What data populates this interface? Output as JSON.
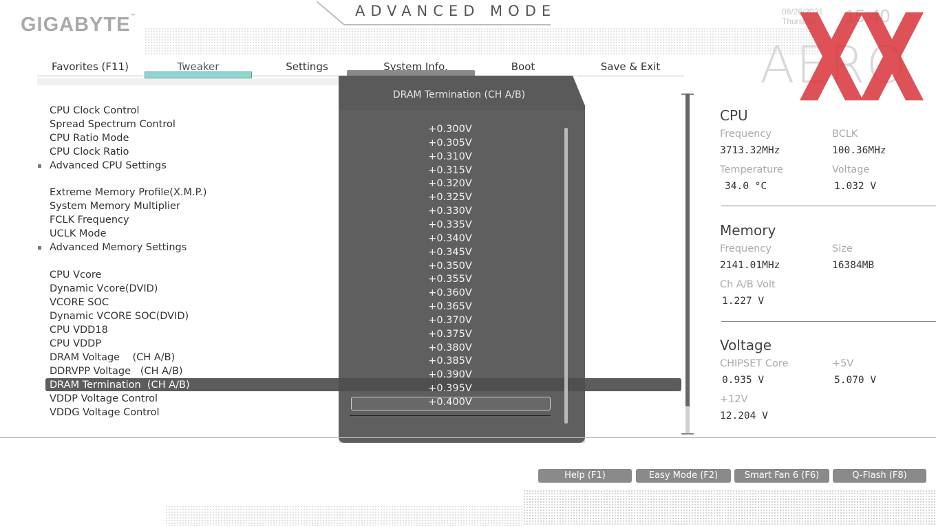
{
  "header": {
    "brand": "GIGABYTE",
    "brand_mark": "™",
    "mode_title": "ADVANCED MODE",
    "date": "08/26/2021",
    "weekday": "Thursday",
    "time": "15:40",
    "aero_logo": "AERO",
    "watermark_color": "#d9343a"
  },
  "tabs": [
    {
      "label": "Favorites (F11)",
      "active": false
    },
    {
      "label": "Tweaker",
      "active": true
    },
    {
      "label": "Settings",
      "active": false
    },
    {
      "label": "System Info.",
      "active": false
    },
    {
      "label": "Boot",
      "active": false
    },
    {
      "label": "Save & Exit",
      "active": false
    }
  ],
  "menu": [
    {
      "label": "CPU Clock Control"
    },
    {
      "label": "Spread Spectrum Control"
    },
    {
      "label": "CPU Ratio Mode"
    },
    {
      "label": "CPU Clock Ratio"
    },
    {
      "label": "Advanced CPU Settings",
      "submenu": true
    },
    {
      "label": "Extreme Memory Profile(X.M.P.)"
    },
    {
      "label": "System Memory Multiplier"
    },
    {
      "label": "FCLK Frequency"
    },
    {
      "label": "UCLK Mode"
    },
    {
      "label": "Advanced Memory Settings",
      "submenu": true
    },
    {
      "label": "CPU Vcore"
    },
    {
      "label": "Dynamic Vcore(DVID)"
    },
    {
      "label": "VCORE SOC"
    },
    {
      "label": "Dynamic VCORE SOC(DVID)"
    },
    {
      "label": "CPU VDD18"
    },
    {
      "label": "CPU VDDP"
    },
    {
      "label": "DRAM Voltage    (CH A/B)"
    },
    {
      "label": "DDRVPP Voltage   (CH A/B)"
    },
    {
      "label": "DRAM Termination  (CH A/B)",
      "selected": true
    },
    {
      "label": "VDDP Voltage Control"
    },
    {
      "label": "VDDG Voltage Control"
    }
  ],
  "popup": {
    "title": "DRAM Termination  (CH A/B)",
    "options": [
      "+0.300V",
      "+0.305V",
      "+0.310V",
      "+0.315V",
      "+0.320V",
      "+0.325V",
      "+0.330V",
      "+0.335V",
      "+0.340V",
      "+0.345V",
      "+0.350V",
      "+0.355V",
      "+0.360V",
      "+0.365V",
      "+0.370V",
      "+0.375V",
      "+0.380V",
      "+0.385V",
      "+0.390V",
      "+0.395V",
      "+0.400V"
    ],
    "selected": "+0.400V"
  },
  "sidebar": {
    "cpu": {
      "title": "CPU",
      "frequency_label": "Frequency",
      "frequency": "3713.32MHz",
      "bclk_label": "BCLK",
      "bclk": "100.36MHz",
      "temperature_label": "Temperature",
      "temperature": "34.0 °C",
      "voltage_label": "Voltage",
      "voltage": "1.032 V"
    },
    "memory": {
      "title": "Memory",
      "frequency_label": "Frequency",
      "frequency": "2141.01MHz",
      "size_label": "Size",
      "size": "16384MB",
      "volt_label": "Ch A/B Volt",
      "volt": "1.227 V"
    },
    "voltage": {
      "title": "Voltage",
      "chipset_label": "CHIPSET Core",
      "chipset": "0.935 V",
      "v5_label": "+5V",
      "v5": "5.070 V",
      "v12_label": "+12V",
      "v12": "12.204 V"
    }
  },
  "footer": {
    "buttons": [
      {
        "label": "Help (F1)"
      },
      {
        "label": "Easy Mode (F2)"
      },
      {
        "label": "Smart Fan 6 (F6)"
      },
      {
        "label": "Q-Flash (F8)"
      }
    ]
  }
}
